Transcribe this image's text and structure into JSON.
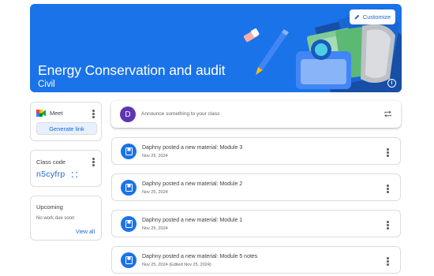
{
  "banner": {
    "title": "Energy Conservation and audit",
    "subtitle": "Civil",
    "customize_label": "Customize",
    "color": "#1a73e8"
  },
  "meet": {
    "label": "Meet",
    "generate_label": "Generate link"
  },
  "class_code": {
    "label": "Class code",
    "code": "n5cyfrp"
  },
  "upcoming": {
    "title": "Upcoming",
    "empty_text": "No work due soon",
    "view_all_label": "View all"
  },
  "announce": {
    "avatar_initial": "D",
    "placeholder": "Announce something to your class"
  },
  "posts": [
    {
      "title": "Daphny posted a new material: Module 3",
      "date": "Nov 25, 2024"
    },
    {
      "title": "Daphny posted a new material: Module 2",
      "date": "Nov 25, 2024"
    },
    {
      "title": "Daphny posted a new material: Module 1",
      "date": "Nov 25, 2024"
    },
    {
      "title": "Daphny posted a new material: Module 5 notes",
      "date": "Nov 25, 2024 (Edited Nov 25, 2024)"
    }
  ],
  "icons": {
    "customize": "pencil-icon",
    "info": "info-icon",
    "meet": "meet-icon",
    "more": "more-vert-icon",
    "fullscreen": "fullscreen-icon",
    "repost": "repost-icon",
    "material": "material-icon"
  }
}
